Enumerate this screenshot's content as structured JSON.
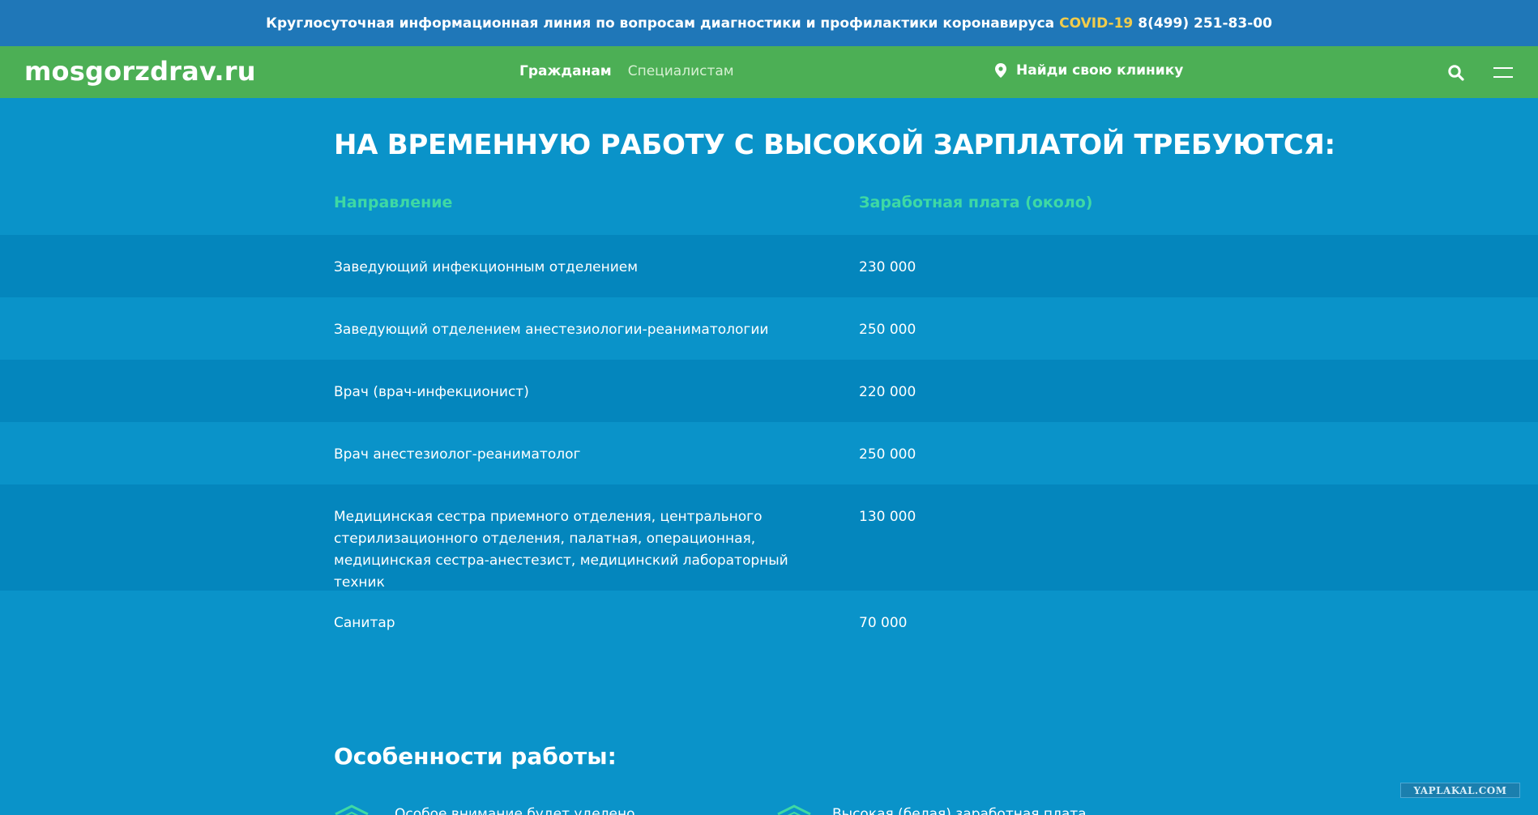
{
  "topbar": {
    "message": "Круглосуточная информационная линия по вопросам диагностики и профилактики коронавируса",
    "covid": "COVID-19",
    "phone": "8(499) 251-83-00"
  },
  "navbar": {
    "logo": "mosgorzdrav.ru",
    "links": [
      "Гражданам",
      "Специалистам"
    ],
    "clinic_label": "Найди свою клинику"
  },
  "page": {
    "title": "НА ВРЕМЕННУЮ РАБОТУ С ВЫСОКОЙ ЗАРПЛАТОЙ ТРЕБУЮТСЯ:",
    "table": {
      "headers": [
        "Направление",
        "Заработная плата (около)"
      ],
      "rows": [
        {
          "position": "Заведующий инфекционным отделением",
          "salary": "230 000"
        },
        {
          "position": "Заведующий отделением анестезиологии-реаниматологии",
          "salary": "250 000"
        },
        {
          "position": "Врач (врач-инфекционист)",
          "salary": "220 000"
        },
        {
          "position": "Врач анестезиолог-реаниматолог",
          "salary": "250 000"
        },
        {
          "position": "Медицинская сестра приемного отделения, центрального стерилизационного отделения, палатная, операционная, медицинская сестра-анестезист, медицинский лабораторный техник",
          "salary": "130 000"
        },
        {
          "position": "Санитар",
          "salary": "70 000"
        }
      ]
    },
    "features_title": "Особенности работы:",
    "features": [
      "Особое внимание будет уделено",
      "Высокая (белая) заработная плата"
    ]
  },
  "watermark": "YAPLAKAL.COM",
  "colors": {
    "topbar": "#1f77b8",
    "navbar": "#4caf55",
    "background": "#0a93c9",
    "row_dark": "#0486bd",
    "accent_green": "#3ed9a4",
    "accent_yellow": "#f2cc4b"
  }
}
